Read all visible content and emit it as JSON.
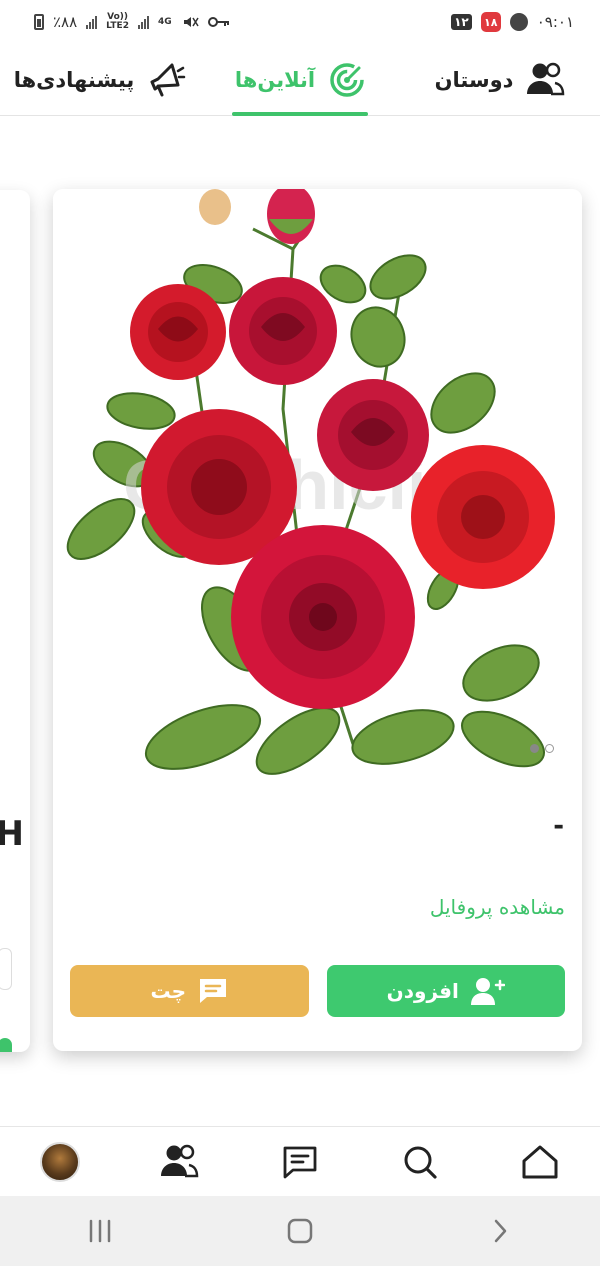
{
  "status_bar": {
    "time": "۰۹:۰۱",
    "date_badge": "۱۲",
    "red_badge": "۱۸",
    "battery": "٪۸۸",
    "network": "4G",
    "volte": "Vo))",
    "lte": "LTE2"
  },
  "tabs": [
    {
      "label": "دوستان",
      "icon": "friends-icon",
      "active": false
    },
    {
      "label": "آنلاین‌ها",
      "icon": "radar-icon",
      "active": true
    },
    {
      "label": "پیشنهادی‌ها",
      "icon": "megaphone-icon",
      "active": false
    }
  ],
  "card": {
    "name": "-",
    "view_profile": "مشاهده پروفایل",
    "add_label": "افزودن",
    "chat_label": "چت",
    "photo_watermark": "Graphicline",
    "photo_pages": 2,
    "photo_current_page": 2
  },
  "peek_card": {
    "name_fragment": "H"
  },
  "bottom_nav": [
    {
      "name": "home-icon"
    },
    {
      "name": "search-icon"
    },
    {
      "name": "messages-icon"
    },
    {
      "name": "friends-icon"
    },
    {
      "name": "avatar"
    }
  ],
  "colors": {
    "accent_green": "#3ec36b",
    "add_button": "#3ec96f",
    "chat_button": "#eab655"
  }
}
